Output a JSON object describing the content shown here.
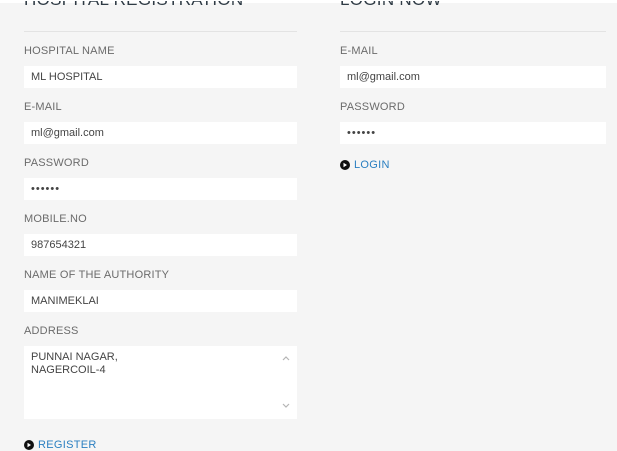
{
  "registration": {
    "title": "HOSPITAL REGISTRATION",
    "fields": [
      {
        "label": "HOSPITAL NAME",
        "value": "ML HOSPITAL"
      },
      {
        "label": "E-MAIL",
        "value": "ml@gmail.com"
      },
      {
        "label": "PASSWORD",
        "value": "••••••"
      },
      {
        "label": "MOBILE.NO",
        "value": "987654321"
      },
      {
        "label": "NAME OF THE AUTHORITY",
        "value": "MANIMEKLAI"
      }
    ],
    "address_label": "ADDRESS",
    "address_lines": [
      "PUNNAI NAGAR,",
      "NAGERCOIL-4"
    ],
    "register_label": "REGISTER"
  },
  "login": {
    "title": "LOGIN NOW",
    "email_label": "E-MAIL",
    "email_value": "ml@gmail.com",
    "password_label": "PASSWORD",
    "password_value": "••••••",
    "login_label": "LOGIN"
  },
  "icons": {
    "action_icon": "play-circle-icon",
    "scroll_up": "chevron-up-icon",
    "scroll_down": "chevron-down-icon"
  },
  "colors": {
    "background": "#f5f5f5",
    "input_bg": "#ffffff",
    "link": "#2a7fc1",
    "heading": "#2f3b45"
  }
}
